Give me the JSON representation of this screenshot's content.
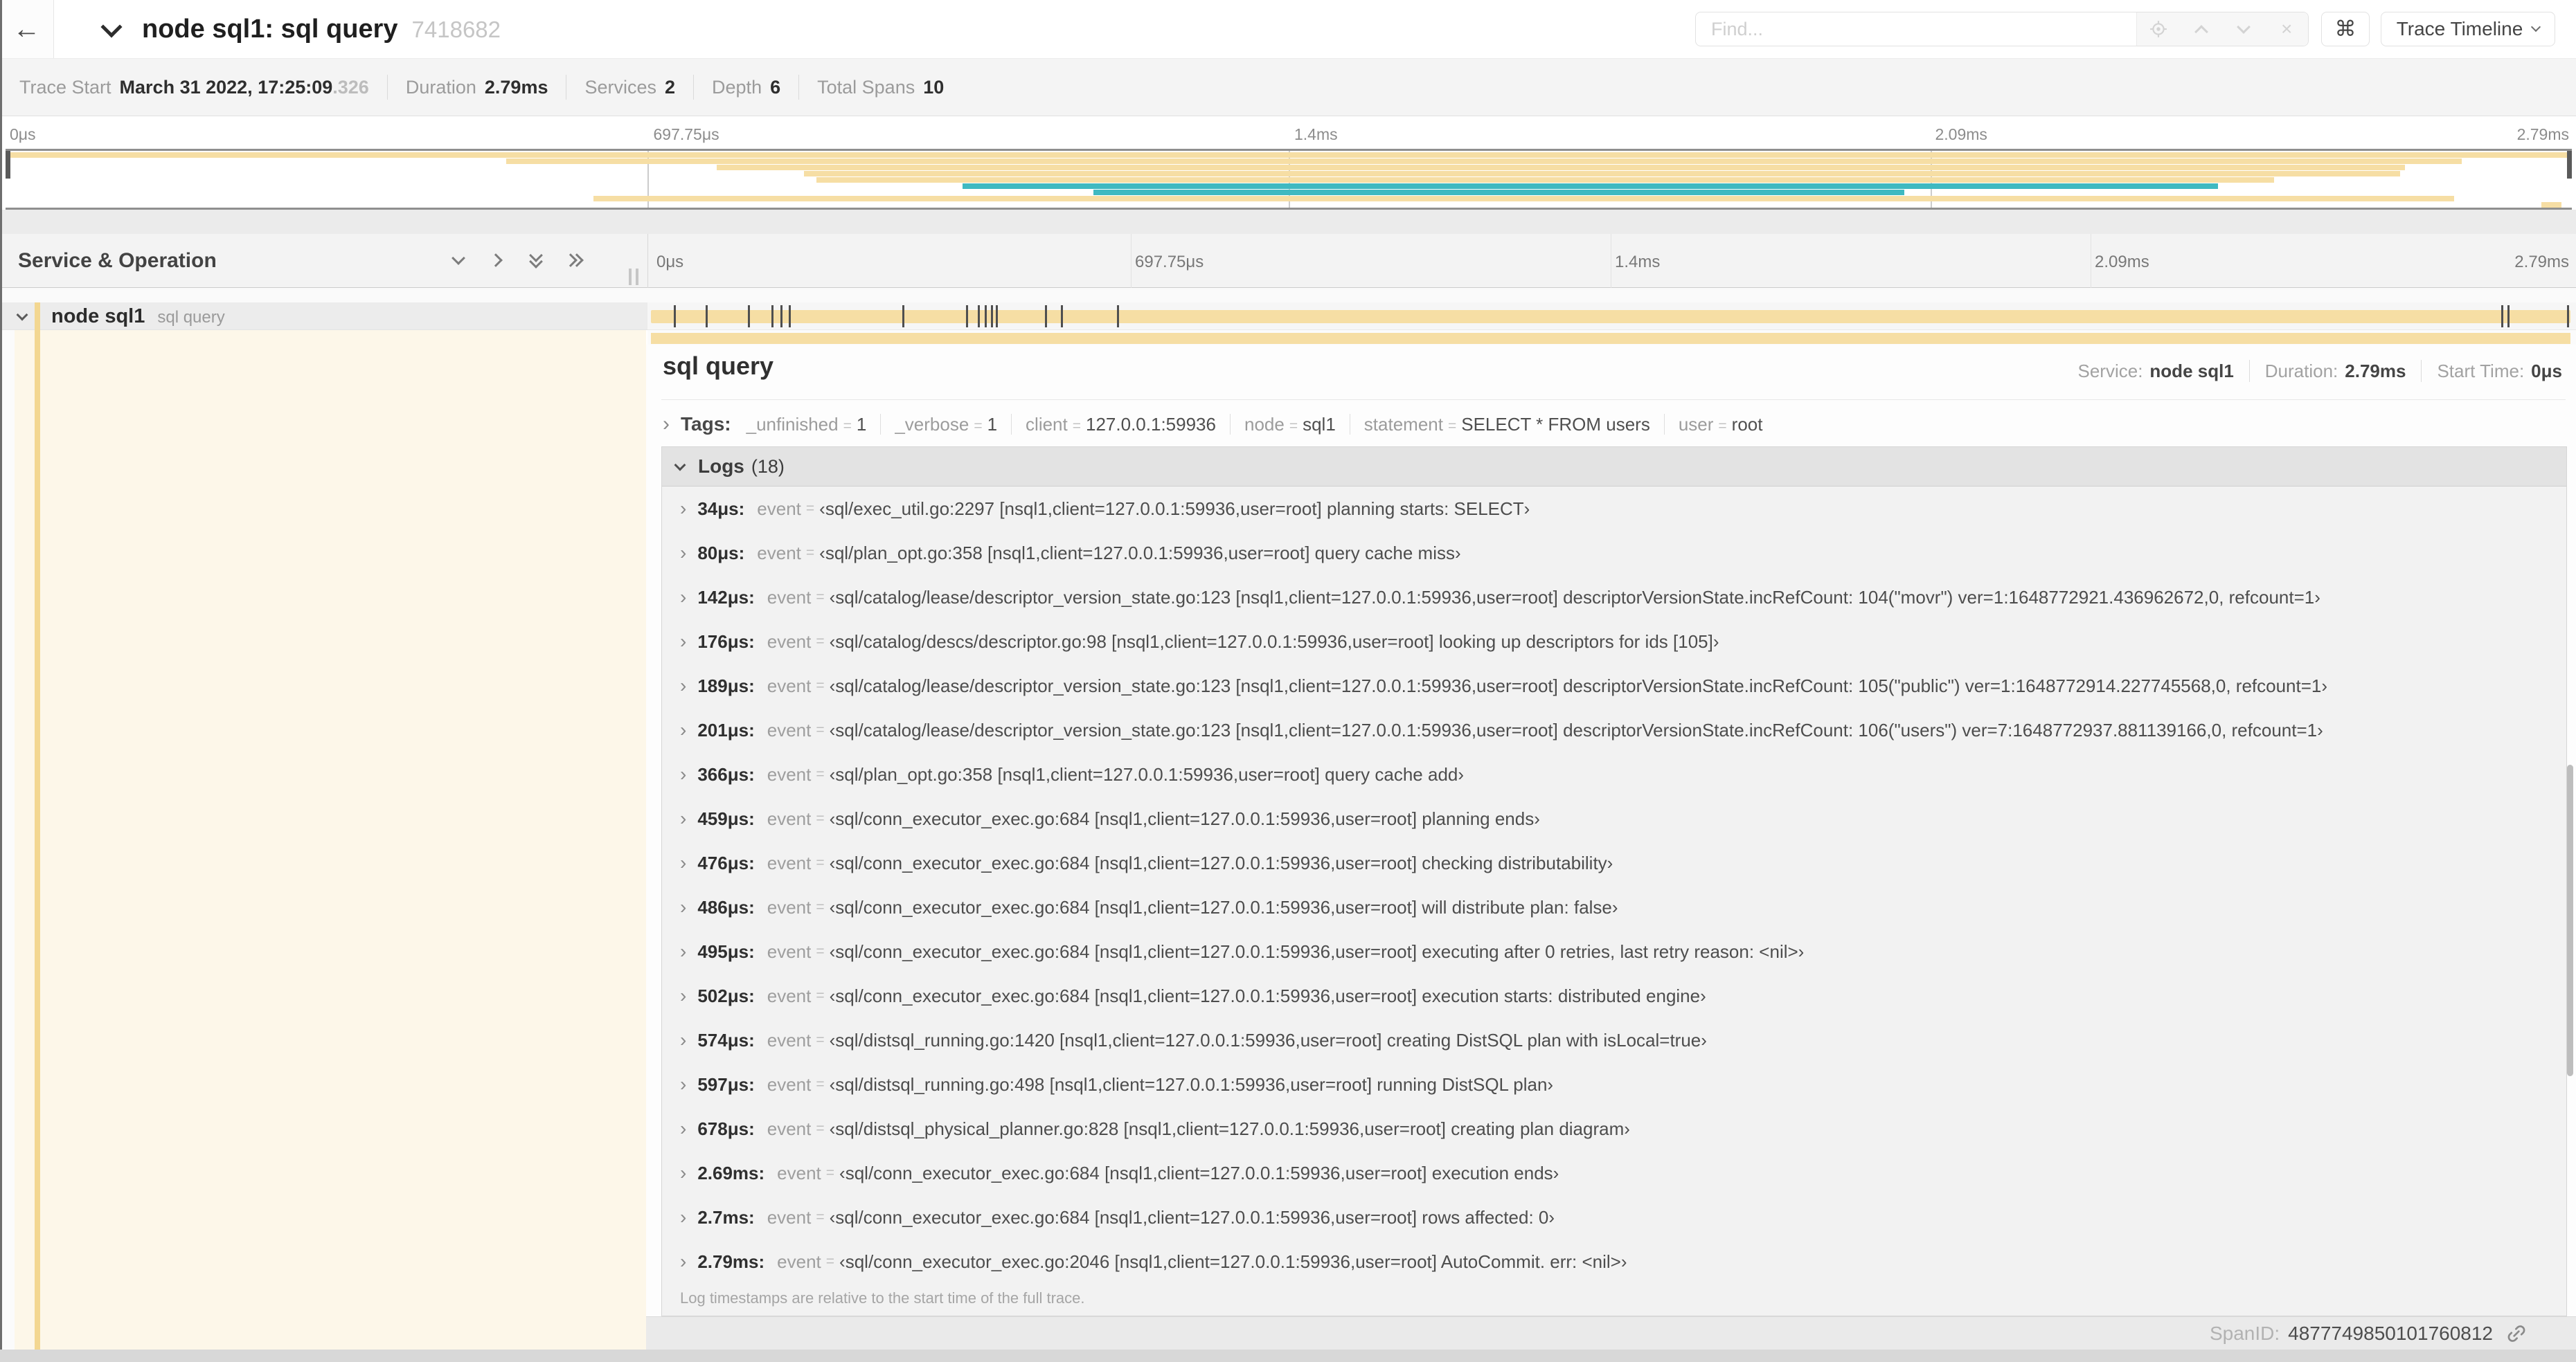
{
  "colors": {
    "tan": "#f6dea4",
    "teal": "#3fb9c1",
    "cream": "#fdf7e9",
    "chip": "#f3d791"
  },
  "header": {
    "title": "node sql1: sql query",
    "trace_id": "7418682",
    "find_placeholder": "Find...",
    "shortcut_glyph": "⌘",
    "view_dropdown": "Trace Timeline"
  },
  "summary": {
    "items": [
      {
        "label": "Trace Start",
        "value": "March 31 2022, 17:25:09",
        "suffix": ".326"
      },
      {
        "label": "Duration",
        "value": "2.79ms"
      },
      {
        "label": "Services",
        "value": "2"
      },
      {
        "label": "Depth",
        "value": "6"
      },
      {
        "label": "Total Spans",
        "value": "10"
      }
    ]
  },
  "timeline": {
    "left_header": "Service & Operation",
    "ticks": [
      {
        "label": "0μs",
        "pct": 0
      },
      {
        "label": "697.75μs",
        "pct": 25
      },
      {
        "label": "1.4ms",
        "pct": 50
      },
      {
        "label": "2.09ms",
        "pct": 75
      },
      {
        "label": "2.79ms",
        "pct": 100
      }
    ],
    "row": {
      "service": "node sql1",
      "operation": "sql query",
      "bar_start_pct": 0,
      "bar_end_pct": 100,
      "color": "tan"
    },
    "log_marker_pcts": [
      1.22,
      2.87,
      5.09,
      6.31,
      6.77,
      7.2,
      13.12,
      16.45,
      17.06,
      17.42,
      17.74,
      17.99,
      20.57,
      21.4,
      24.3,
      96.42,
      96.77,
      99.85
    ]
  },
  "minimap": {
    "spans": [
      {
        "start": 0,
        "end": 100,
        "color": "tan"
      },
      {
        "start": 19.5,
        "end": 95.7,
        "color": "tan"
      },
      {
        "start": 27.7,
        "end": 93.5,
        "color": "tan"
      },
      {
        "start": 31.1,
        "end": 93.3,
        "color": "tan"
      },
      {
        "start": 31.6,
        "end": 88.4,
        "color": "tan"
      },
      {
        "start": 37.3,
        "end": 86.2,
        "color": "teal"
      },
      {
        "start": 42.4,
        "end": 74.0,
        "color": "teal"
      },
      {
        "start": 22.9,
        "end": 95.4,
        "color": "tan"
      },
      {
        "start": 98.8,
        "end": 99.6,
        "color": "tan"
      }
    ],
    "gridline_pcts": [
      25,
      50,
      75
    ]
  },
  "detail": {
    "title": "sql query",
    "meta": [
      {
        "label": "Service:",
        "value": "node sql1"
      },
      {
        "label": "Duration:",
        "value": "2.79ms"
      },
      {
        "label": "Start Time:",
        "value": "0μs"
      }
    ],
    "tags_label": "Tags:",
    "tags": [
      {
        "key": "_unfinished",
        "value": "1"
      },
      {
        "key": "_verbose",
        "value": "1"
      },
      {
        "key": "client",
        "value": "127.0.0.1:59936"
      },
      {
        "key": "node",
        "value": "sql1"
      },
      {
        "key": "statement",
        "value": "SELECT * FROM users"
      },
      {
        "key": "user",
        "value": "root"
      }
    ],
    "logs_label": "Logs",
    "logs_count": "(18)",
    "logs": [
      {
        "time": "34μs:",
        "field": "event",
        "value": "‹sql/exec_util.go:2297 [nsql1,client=127.0.0.1:59936,user=root] planning starts: SELECT›"
      },
      {
        "time": "80μs:",
        "field": "event",
        "value": "‹sql/plan_opt.go:358 [nsql1,client=127.0.0.1:59936,user=root] query cache miss›"
      },
      {
        "time": "142μs:",
        "field": "event",
        "value": "‹sql/catalog/lease/descriptor_version_state.go:123 [nsql1,client=127.0.0.1:59936,user=root] descriptorVersionState.incRefCount: 104(\"movr\") ver=1:1648772921.436962672,0, refcount=1›"
      },
      {
        "time": "176μs:",
        "field": "event",
        "value": "‹sql/catalog/descs/descriptor.go:98 [nsql1,client=127.0.0.1:59936,user=root] looking up descriptors for ids [105]›"
      },
      {
        "time": "189μs:",
        "field": "event",
        "value": "‹sql/catalog/lease/descriptor_version_state.go:123 [nsql1,client=127.0.0.1:59936,user=root] descriptorVersionState.incRefCount: 105(\"public\") ver=1:1648772914.227745568,0, refcount=1›"
      },
      {
        "time": "201μs:",
        "field": "event",
        "value": "‹sql/catalog/lease/descriptor_version_state.go:123 [nsql1,client=127.0.0.1:59936,user=root] descriptorVersionState.incRefCount: 106(\"users\") ver=7:1648772937.881139166,0, refcount=1›"
      },
      {
        "time": "366μs:",
        "field": "event",
        "value": "‹sql/plan_opt.go:358 [nsql1,client=127.0.0.1:59936,user=root] query cache add›"
      },
      {
        "time": "459μs:",
        "field": "event",
        "value": "‹sql/conn_executor_exec.go:684 [nsql1,client=127.0.0.1:59936,user=root] planning ends›"
      },
      {
        "time": "476μs:",
        "field": "event",
        "value": "‹sql/conn_executor_exec.go:684 [nsql1,client=127.0.0.1:59936,user=root] checking distributability›"
      },
      {
        "time": "486μs:",
        "field": "event",
        "value": "‹sql/conn_executor_exec.go:684 [nsql1,client=127.0.0.1:59936,user=root] will distribute plan: false›"
      },
      {
        "time": "495μs:",
        "field": "event",
        "value": "‹sql/conn_executor_exec.go:684 [nsql1,client=127.0.0.1:59936,user=root] executing after 0 retries, last retry reason: <nil>›"
      },
      {
        "time": "502μs:",
        "field": "event",
        "value": "‹sql/conn_executor_exec.go:684 [nsql1,client=127.0.0.1:59936,user=root] execution starts: distributed engine›"
      },
      {
        "time": "574μs:",
        "field": "event",
        "value": "‹sql/distsql_running.go:1420 [nsql1,client=127.0.0.1:59936,user=root] creating DistSQL plan with isLocal=true›"
      },
      {
        "time": "597μs:",
        "field": "event",
        "value": "‹sql/distsql_running.go:498 [nsql1,client=127.0.0.1:59936,user=root] running DistSQL plan›"
      },
      {
        "time": "678μs:",
        "field": "event",
        "value": "‹sql/distsql_physical_planner.go:828 [nsql1,client=127.0.0.1:59936,user=root] creating plan diagram›"
      },
      {
        "time": "2.69ms:",
        "field": "event",
        "value": "‹sql/conn_executor_exec.go:684 [nsql1,client=127.0.0.1:59936,user=root] execution ends›"
      },
      {
        "time": "2.7ms:",
        "field": "event",
        "value": "‹sql/conn_executor_exec.go:684 [nsql1,client=127.0.0.1:59936,user=root] rows affected: 0›"
      },
      {
        "time": "2.79ms:",
        "field": "event",
        "value": "‹sql/conn_executor_exec.go:2046 [nsql1,client=127.0.0.1:59936,user=root] AutoCommit. err: <nil>›"
      }
    ],
    "logs_footer": "Log timestamps are relative to the start time of the full trace.",
    "span_id_label": "SpanID:",
    "span_id": "4877749850101760812"
  }
}
